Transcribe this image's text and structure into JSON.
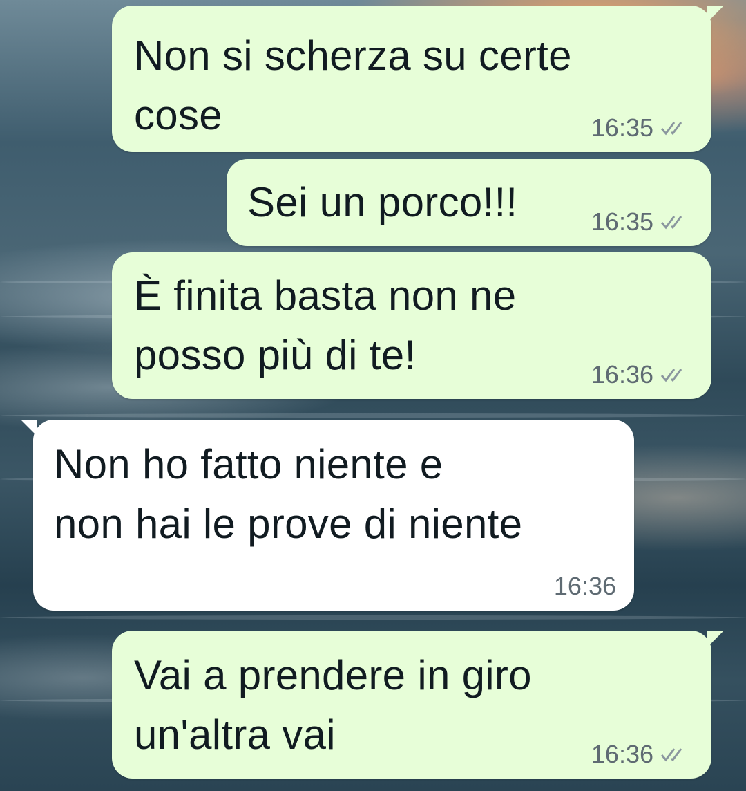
{
  "messages": [
    {
      "direction": "outgoing",
      "text": "Non si scherza su certe\ncose",
      "time": "16:35",
      "status_icon": "double-check-icon"
    },
    {
      "direction": "outgoing",
      "text": "Sei un porco!!!",
      "time": "16:35",
      "status_icon": "double-check-icon"
    },
    {
      "direction": "outgoing",
      "text": "È finita basta non ne\nposso più di te!",
      "time": "16:36",
      "status_icon": "double-check-icon"
    },
    {
      "direction": "incoming",
      "text": "Non ho fatto niente e\nnon hai le prove di niente",
      "time": "16:36"
    },
    {
      "direction": "outgoing",
      "text": "Vai a prendere in giro\nun'altra vai",
      "time": "16:36",
      "status_icon": "double-check-icon"
    }
  ],
  "colors": {
    "outgoing_bubble": "#e7fed8",
    "incoming_bubble": "#ffffff",
    "timestamp": "#5f6b73"
  }
}
